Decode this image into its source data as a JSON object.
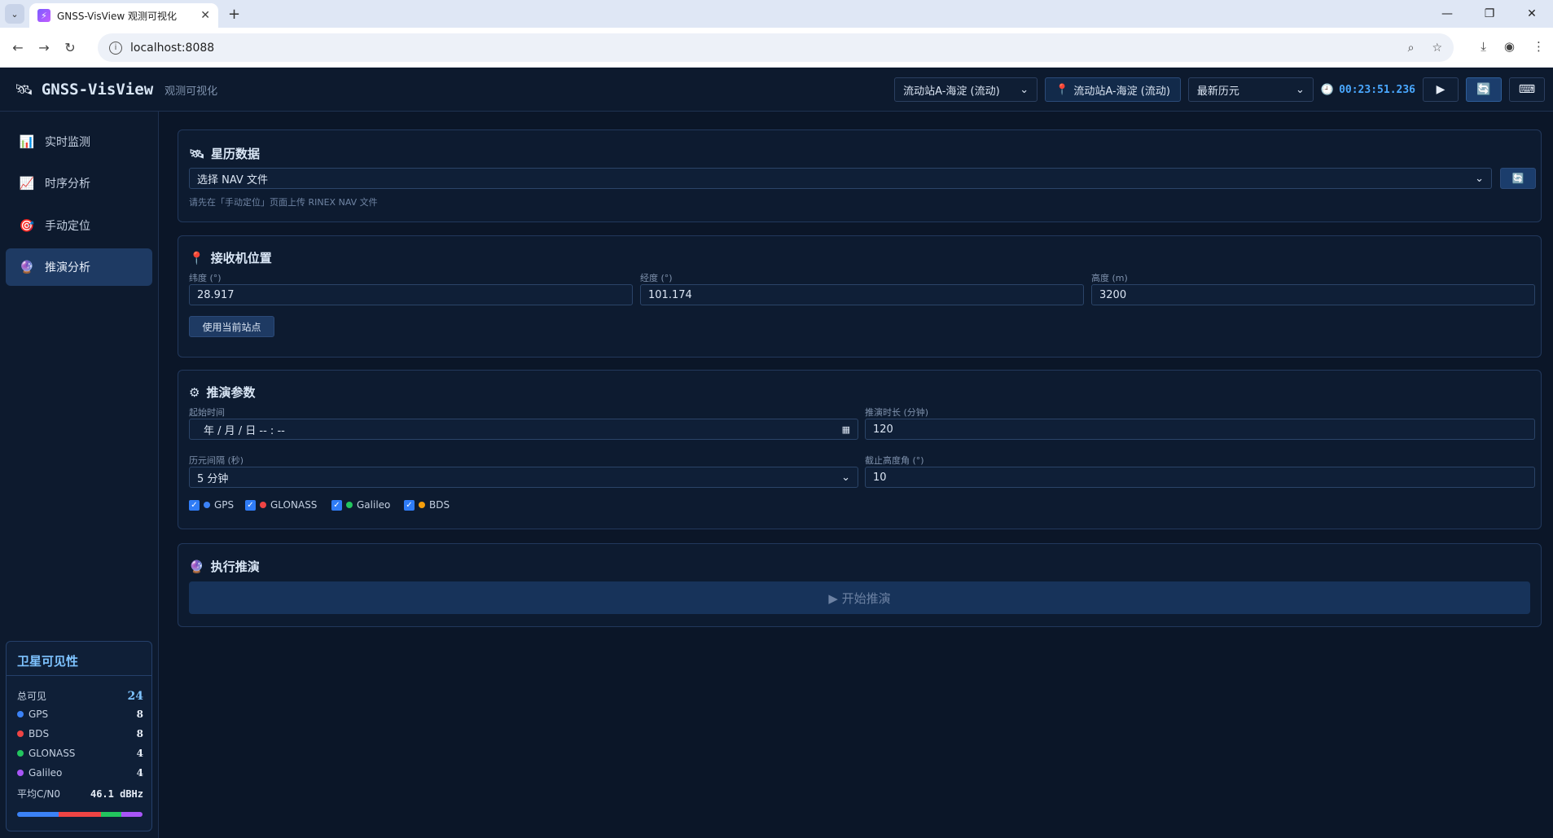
{
  "browser": {
    "tab_title": "GNSS-VisView 观测可视化",
    "url": "localhost:8088"
  },
  "header": {
    "app_name": "GNSS-VisView",
    "app_subtitle": "观测可视化",
    "station_select": "流动站A-海淀 (流动)",
    "station_chip": "流动站A-海淀 (流动)",
    "epoch_select": "最新历元",
    "clock": "00:23:51.236"
  },
  "sidebar": {
    "items": [
      {
        "label": "实时监测",
        "icon": "bar-chart-icon"
      },
      {
        "label": "时序分析",
        "icon": "line-chart-icon"
      },
      {
        "label": "手动定位",
        "icon": "target-icon"
      },
      {
        "label": "推演分析",
        "icon": "crystal-ball-icon"
      }
    ],
    "active_index": 3
  },
  "visibility": {
    "title": "卫星可见性",
    "total_label": "总可见",
    "total_value": "24",
    "systems": [
      {
        "name": "GPS",
        "count": "8",
        "color": "#3b82f6"
      },
      {
        "name": "BDS",
        "count": "8",
        "color": "#ef4444"
      },
      {
        "name": "GLONASS",
        "count": "4",
        "color": "#22c55e"
      },
      {
        "name": "Galileo",
        "count": "4",
        "color": "#a855f7"
      }
    ],
    "cn0_label": "平均C/N0",
    "cn0_value": "46.1 dBHz"
  },
  "ephemeris": {
    "title": "星历数据",
    "select_value": "选择 NAV 文件",
    "hint": "请先在「手动定位」页面上传 RINEX NAV 文件"
  },
  "receiver": {
    "title": "接收机位置",
    "lat_label": "纬度 (°)",
    "lat_value": "28.917",
    "lon_label": "经度 (°)",
    "lon_value": "101.174",
    "alt_label": "高度 (m)",
    "alt_value": "3200",
    "use_station_button": "使用当前站点"
  },
  "params": {
    "title": "推演参数",
    "start_label": "起始时间",
    "start_value": "年 / 月 / 日  -- : --",
    "duration_label": "推演时长 (分钟)",
    "duration_value": "120",
    "interval_label": "历元间隔 (秒)",
    "interval_value": "5 分钟",
    "cutoff_label": "截止高度角 (°)",
    "cutoff_value": "10",
    "systems": [
      {
        "name": "GPS",
        "color": "#3b82f6",
        "checked": true
      },
      {
        "name": "GLONASS",
        "color": "#ef4444",
        "checked": true
      },
      {
        "name": "Galileo",
        "color": "#22c55e",
        "checked": true
      },
      {
        "name": "BDS",
        "color": "#f59e0b",
        "checked": true
      }
    ]
  },
  "execute": {
    "title": "执行推演",
    "start_button": "▶ 开始推演"
  }
}
